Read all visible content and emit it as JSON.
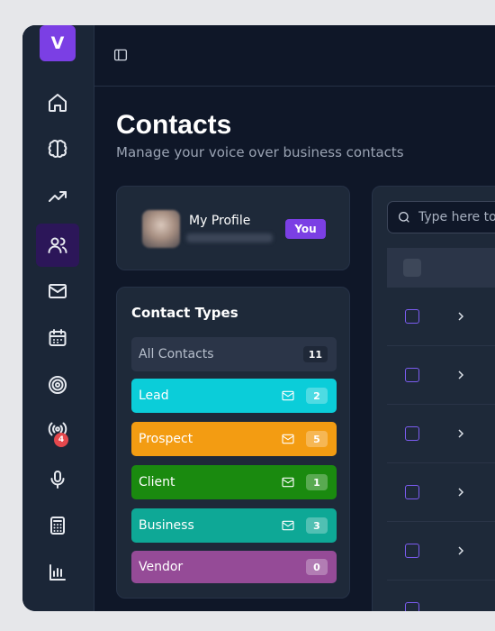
{
  "brand": {
    "logo_letter": "V",
    "accent": "#7b3fe4"
  },
  "sidebar": {
    "items": [
      {
        "icon": "home-icon",
        "active": false
      },
      {
        "icon": "brain-icon",
        "active": false
      },
      {
        "icon": "trending-up-icon",
        "active": false
      },
      {
        "icon": "users-icon",
        "active": true
      },
      {
        "icon": "mail-icon",
        "active": false
      },
      {
        "icon": "calendar-icon",
        "active": false
      },
      {
        "icon": "target-icon",
        "active": false
      },
      {
        "icon": "broadcast-icon",
        "active": false,
        "badge": "4"
      },
      {
        "icon": "microphone-icon",
        "active": false
      },
      {
        "icon": "calculator-icon",
        "active": false
      },
      {
        "icon": "bar-chart-icon",
        "active": false
      }
    ]
  },
  "page": {
    "title": "Contacts",
    "subtitle": "Manage your voice over business contacts"
  },
  "profile": {
    "name": "My Profile",
    "badge": "You"
  },
  "contact_types": {
    "title": "Contact Types",
    "items": [
      {
        "label": "All Contacts",
        "count": "11",
        "color": "#2b3548",
        "mail": false
      },
      {
        "label": "Lead",
        "count": "2",
        "color": "#0bcdd9",
        "mail": true
      },
      {
        "label": "Prospect",
        "count": "5",
        "color": "#f39c12",
        "mail": true
      },
      {
        "label": "Client",
        "count": "1",
        "color": "#1a8a0f",
        "mail": true
      },
      {
        "label": "Business",
        "count": "3",
        "color": "#0ea896",
        "mail": true
      },
      {
        "label": "Vendor",
        "count": "0",
        "color": "#954b97",
        "mail": false
      }
    ]
  },
  "contacts_list": {
    "search_placeholder": "Type here to"
  }
}
